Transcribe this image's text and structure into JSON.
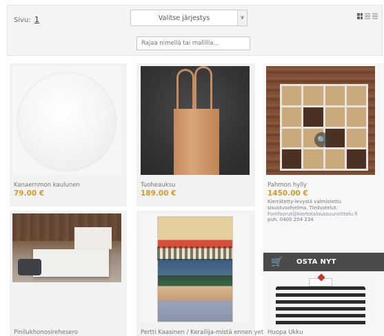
{
  "toolbar": {
    "page_label": "Sivu:",
    "page_number": "1",
    "sort_select_value": "Valitse järjestys",
    "search_placeholder": "Rajaa nimellä tai mallilla...",
    "view_modes": [
      "grid-view-icon",
      "list-view-icon",
      "detail-view-icon"
    ]
  },
  "products": [
    {
      "name": "Kanaernmon kaulunen",
      "price": "79.00 €"
    },
    {
      "name": "Tuoheauksu",
      "price": "189.00 €"
    },
    {
      "name": "Pahmon hylly",
      "price": "1450.00 €",
      "description": "Kierrätetty-levystä valmistettu sisustusohjelma. Tiedustelut:",
      "contact_link": "Fomfoorut@kiertotaloussuunnittelu.fi",
      "phone": "puh. 0400 204 234",
      "buy_label": "OSTA NYT"
    },
    {
      "name": "Pinilukhonosirehesero",
      "price": ""
    },
    {
      "name": "Pertti Kaasinen / Kerailija-mistä ennen yettä",
      "price": ""
    },
    {
      "name": "Huopa Ukku",
      "price": ""
    }
  ],
  "colors": {
    "price": "#d49a2a",
    "card_bg": "#f2f2f2",
    "buy_bar": "#4a4a4a"
  }
}
